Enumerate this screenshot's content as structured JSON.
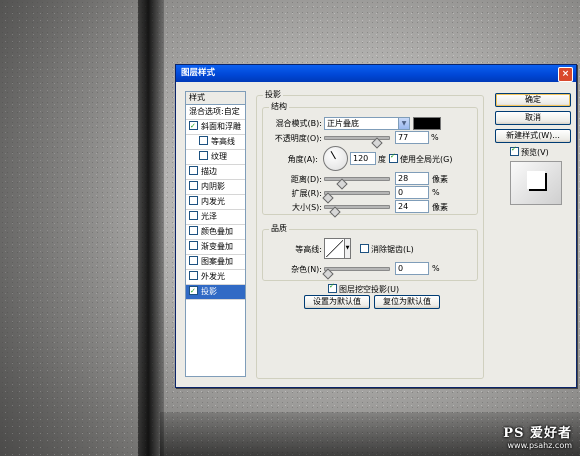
{
  "dialog": {
    "title": "图层样式",
    "close": "×"
  },
  "styles": {
    "header": "样式",
    "items": [
      {
        "label": "混合选项:自定"
      },
      {
        "label": "斜面和浮雕",
        "checked": true
      },
      {
        "label": "等高线",
        "checked": false,
        "sub": true
      },
      {
        "label": "纹理",
        "checked": false,
        "sub": true
      },
      {
        "label": "描边",
        "checked": false
      },
      {
        "label": "内阴影",
        "checked": false
      },
      {
        "label": "内发光",
        "checked": false
      },
      {
        "label": "光泽",
        "checked": false
      },
      {
        "label": "颜色叠加",
        "checked": false
      },
      {
        "label": "渐变叠加",
        "checked": false
      },
      {
        "label": "图案叠加",
        "checked": false
      },
      {
        "label": "外发光",
        "checked": false
      },
      {
        "label": "投影",
        "checked": true,
        "selected": true
      }
    ]
  },
  "drop_shadow": {
    "section_title": "投影",
    "structure": {
      "title": "结构",
      "blend_mode_label": "混合模式(B):",
      "blend_mode_value": "正片叠底",
      "blend_color": "#000000",
      "opacity_label": "不透明度(O):",
      "opacity_value": "77",
      "opacity_fraction": 0.77,
      "percent": "%",
      "angle_label": "角度(A):",
      "angle_value": "120",
      "angle_unit": "度",
      "global_light_label": "使用全局光(G)",
      "global_light_checked": true,
      "distance_label": "距离(D):",
      "distance_value": "28",
      "size_unit": "像素",
      "spread_label": "扩展(R):",
      "spread_value": "0",
      "size_label": "大小(S):",
      "size_value": "24"
    },
    "quality": {
      "title": "品质",
      "contour_label": "等高线:",
      "anti_alias_label": "消除锯齿(L)",
      "anti_alias_checked": false,
      "noise_label": "杂色(N):",
      "noise_value": "0"
    },
    "knockout_label": "图层挖空投影(U)",
    "knockout_checked": true,
    "make_default": "设置为默认值",
    "reset_default": "复位为默认值"
  },
  "buttons": {
    "ok": "确定",
    "cancel": "取消",
    "new_style": "新建样式(W)...",
    "preview_label": "预览(V)",
    "preview_checked": true
  },
  "watermark": {
    "brand": "PS 爱好者",
    "site": "www.psahz.com"
  }
}
